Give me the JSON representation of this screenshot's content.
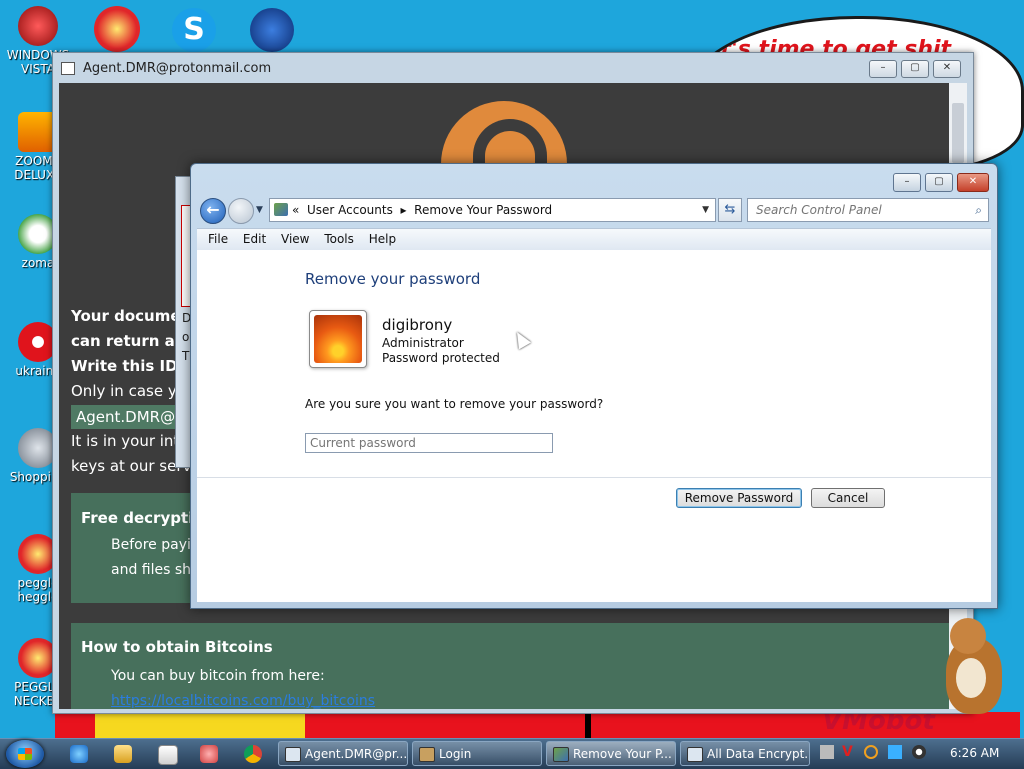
{
  "desktop": {
    "speech": "it's time to get shit",
    "icons": [
      "WINDOWS VISTA",
      "ZOOMA DELUXE",
      "zoma",
      "ukraine",
      "Shopping",
      "peggle heggle",
      "PEGGLE NECKBE"
    ],
    "corner_text": "VMobot"
  },
  "ransom_window": {
    "title": "Agent.DMR@protonmail.com",
    "line1": "Your documen",
    "line2": "can return all",
    "line3": "Write this ID i",
    "line4": "Only in case you",
    "email": "Agent.DMR@ac",
    "line5": "It is in your inter",
    "line6": "keys at our serv",
    "panel1_title": "Free decryptio",
    "panel1_line1": "Before payin",
    "panel1_line2": "and files sho",
    "panel2_title": "How to obtain Bitcoins",
    "panel2_line1": "You can buy bitcoin from here:",
    "panel2_link": "https://localbitcoins.com/buy_bitcoins"
  },
  "login_window": {
    "lines": [
      "D",
      "o",
      "T"
    ]
  },
  "control_panel": {
    "address": {
      "chevrons": "«",
      "crumb1": "User Accounts",
      "sep": "▸",
      "crumb2": "Remove Your Password"
    },
    "search_placeholder": "Search Control Panel",
    "menu": [
      "File",
      "Edit",
      "View",
      "Tools",
      "Help"
    ],
    "heading": "Remove your password",
    "user": {
      "name": "digibrony",
      "role": "Administrator",
      "status": "Password protected"
    },
    "question": "Are you sure you want to remove your password?",
    "password_placeholder": "Current password",
    "buttons": {
      "remove": "Remove Password",
      "cancel": "Cancel"
    }
  },
  "taskbar": {
    "tasks": [
      "Agent.DMR@pr...",
      "Login",
      "Remove Your P...",
      "All Data Encrypt..."
    ],
    "clock": "6:26 AM"
  }
}
